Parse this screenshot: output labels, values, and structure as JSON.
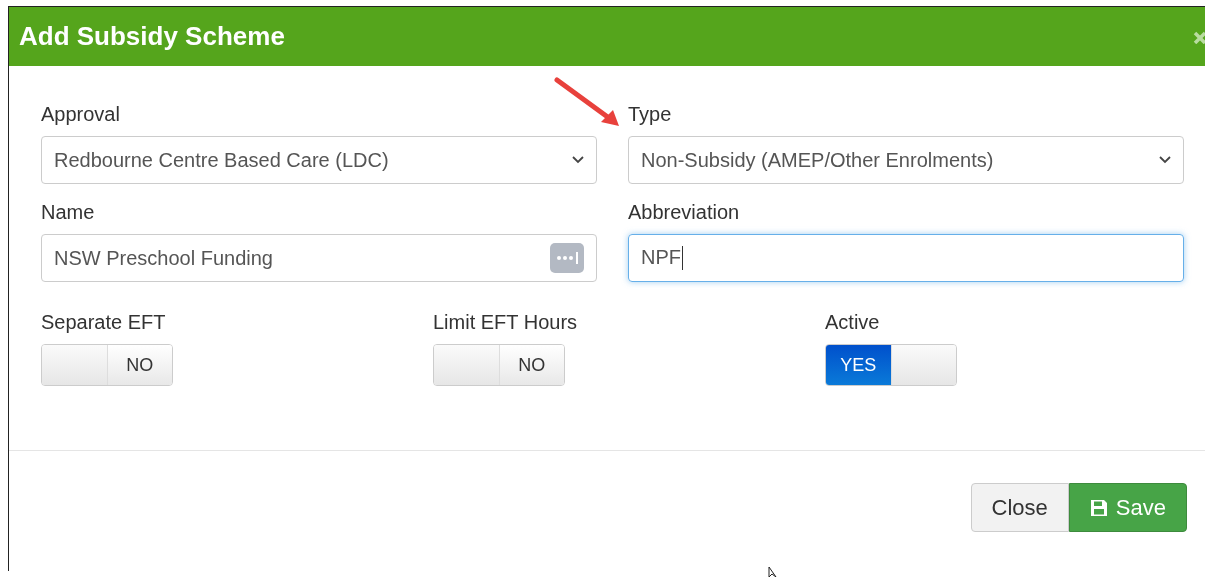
{
  "dialog": {
    "title": "Add Subsidy Scheme"
  },
  "selects": [
    {
      "label": "Approval",
      "value": "Redbourne Centre Based Care (LDC)"
    },
    {
      "label": "Type",
      "value": "Non-Subsidy (AMEP/Other Enrolments)"
    }
  ],
  "fields": [
    {
      "label": "Name",
      "value": "NSW Preschool Funding",
      "focused": false,
      "kind": "lookup"
    },
    {
      "label": "Abbreviation",
      "value": "NPF",
      "focused": true,
      "kind": "text"
    }
  ],
  "toggles": [
    {
      "label": "Separate EFT",
      "on": false,
      "state_text": "NO"
    },
    {
      "label": "Limit EFT Hours",
      "on": false,
      "state_text": "NO"
    },
    {
      "label": "Active",
      "on": true,
      "state_text": "YES"
    }
  ],
  "buttons": [
    {
      "label": "Close",
      "kind": "default"
    },
    {
      "label": "Save",
      "kind": "primary"
    }
  ]
}
